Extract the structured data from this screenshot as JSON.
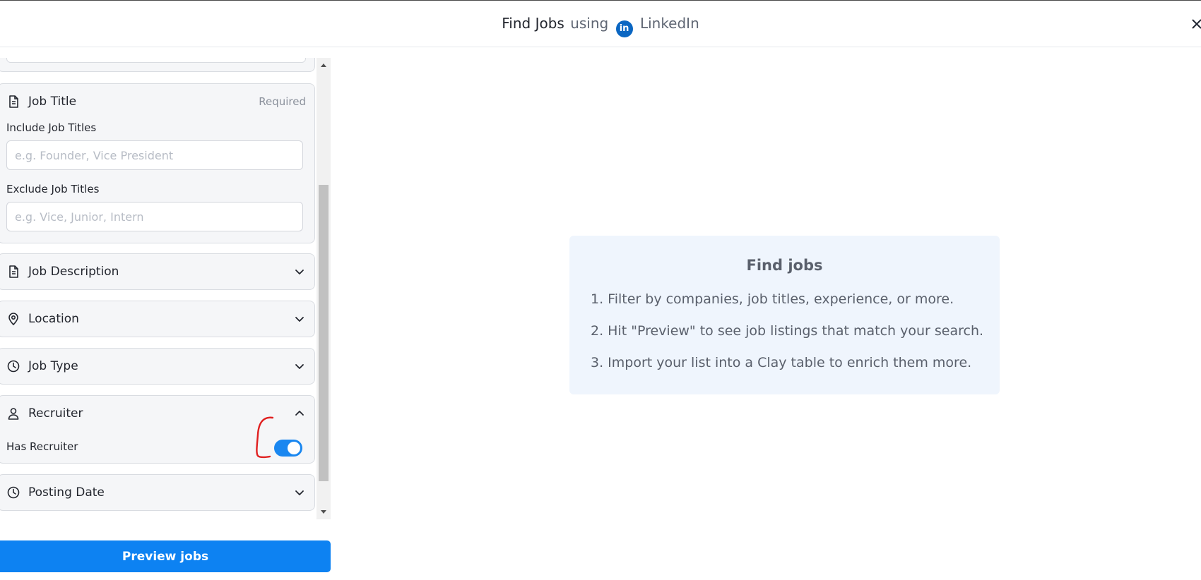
{
  "header": {
    "title_main": "Find Jobs",
    "title_using": "using",
    "logo_letters": "in",
    "title_brand": "LinkedIn",
    "brand_color": "#0a66c2"
  },
  "sidebar": {
    "job_title": {
      "label": "Job Title",
      "required": "Required",
      "icon": "document-icon",
      "include_label": "Include Job Titles",
      "include_placeholder": "e.g. Founder, Vice President",
      "exclude_label": "Exclude Job Titles",
      "exclude_placeholder": "e.g. Vice, Junior, Intern"
    },
    "collapsed_sections": [
      {
        "label": "Job Description",
        "icon": "document-icon"
      },
      {
        "label": "Location",
        "icon": "location-pin-icon"
      },
      {
        "label": "Job Type",
        "icon": "clock-icon"
      }
    ],
    "recruiter": {
      "label": "Recruiter",
      "icon": "person-icon",
      "toggle_label": "Has Recruiter",
      "toggle_on": true
    },
    "posting_date": {
      "label": "Posting Date",
      "icon": "clock-icon"
    }
  },
  "actions": {
    "preview_label": "Preview jobs",
    "accent_color": "#0d82f2"
  },
  "info": {
    "title": "Find jobs",
    "steps": [
      "1. Filter by companies, job titles, experience, or more.",
      "2. Hit \"Preview\" to see job listings that match your search.",
      "3. Import your list into a Clay table to enrich them more."
    ]
  }
}
